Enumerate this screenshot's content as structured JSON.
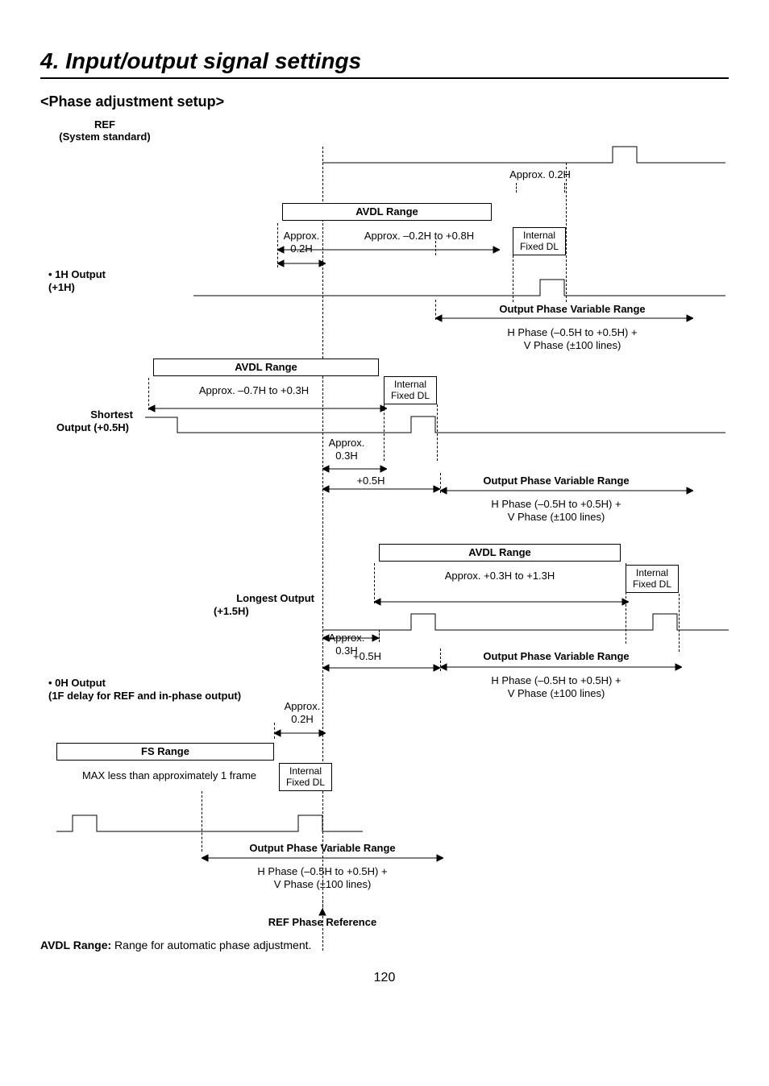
{
  "header": {
    "chapter": "4. Input/output signal settings",
    "section": "<Phase adjustment setup>"
  },
  "labels": {
    "ref_title": "REF",
    "ref_sub": "(System standard)",
    "approx02h_top": "Approx. 0.2H",
    "avdl_range": "AVDL Range",
    "avdl_val_1": "Approx. –0.2H to +0.8H",
    "approx02h_l1": "Approx.\n0.2H",
    "internal_fixed_dl": "Internal\nFixed DL",
    "out1h": "• 1H Output",
    "out1h_sub": "(+1H)",
    "opvr": "Output Phase Variable Range",
    "hphase": "H Phase (–0.5H to +0.5H) +",
    "vphase": "V Phase (±100 lines)",
    "avdl_val_2": "Approx. –0.7H to +0.3H",
    "shortest": "Shortest",
    "shortest_sub": "Output (+0.5H)",
    "approx03h": "Approx.\n0.3H",
    "plus05h": "+0.5H",
    "avdl_val_3": "Approx. +0.3H to +1.3H",
    "longest": "Longest Output",
    "longest_sub": "(+1.5H)",
    "out0h": "• 0H Output",
    "out0h_sub": "(1F delay for REF and in-phase output)",
    "approx02h_l4": "Approx.\n0.2H",
    "fs_range": "FS Range",
    "fs_val": "MAX less than approximately 1 frame",
    "ref_phase_reference": "REF Phase Reference"
  },
  "footnote": {
    "bold": "AVDL Range:",
    "text": " Range for automatic phase adjustment."
  },
  "page_number": "120"
}
